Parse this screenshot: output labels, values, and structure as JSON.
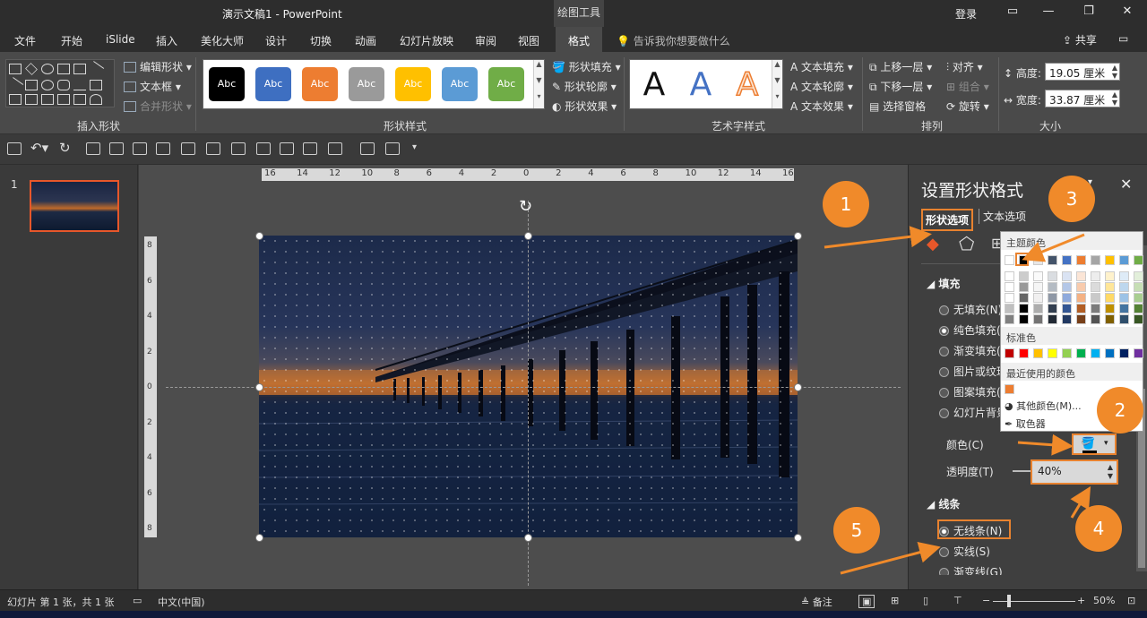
{
  "titlebar": {
    "doc_title": "演示文稿1  -  PowerPoint",
    "tool_context": "绘图工具",
    "login": "登录"
  },
  "tabs": [
    {
      "label": "文件"
    },
    {
      "label": "开始"
    },
    {
      "label": "iSlide"
    },
    {
      "label": "插入"
    },
    {
      "label": "美化大师"
    },
    {
      "label": "设计"
    },
    {
      "label": "切换"
    },
    {
      "label": "动画"
    },
    {
      "label": "幻灯片放映"
    },
    {
      "label": "审阅"
    },
    {
      "label": "视图"
    },
    {
      "label": "格式"
    }
  ],
  "tell_me": "告诉我你想要做什么",
  "share_label": "共享",
  "ribbon": {
    "insert_shapes": {
      "label": "插入形状",
      "edit_shape": "编辑形状",
      "text_box": "文本框",
      "merge_shapes": "合并形状"
    },
    "shape_styles": {
      "label": "形状样式",
      "sample_text": "Abc",
      "swatches": [
        "#000000",
        "#3e6fc1",
        "#ed7d31",
        "#9a9a9a",
        "#ffc000",
        "#5b9bd5",
        "#70ad47"
      ],
      "fill": "形状填充",
      "outline": "形状轮廓",
      "effects": "形状效果"
    },
    "wordart": {
      "label": "艺术字样式",
      "letter": "A",
      "text_fill": "文本填充",
      "text_outline": "文本轮廓",
      "text_effects": "文本效果"
    },
    "arrange": {
      "label": "排列",
      "bring_forward": "上移一层",
      "send_backward": "下移一层",
      "selection_pane": "选择窗格",
      "align": "对齐",
      "group": "组合",
      "rotate": "旋转"
    },
    "size": {
      "label": "大小",
      "height_label": "高度:",
      "height_value": "19.05 厘米",
      "width_label": "宽度:",
      "width_value": "33.87 厘米"
    }
  },
  "slide_pane": {
    "slide_number": "1"
  },
  "ruler": {
    "h_ticks": [
      "16",
      "14",
      "12",
      "10",
      "8",
      "6",
      "4",
      "2",
      "0",
      "2",
      "4",
      "6",
      "8",
      "10",
      "12",
      "14",
      "16"
    ],
    "v_ticks": [
      "8",
      "6",
      "4",
      "2",
      "0",
      "2",
      "4",
      "6",
      "8"
    ]
  },
  "format_pane": {
    "title": "设置形状格式",
    "tab_shape": "形状选项",
    "tab_text": "文本选项",
    "fill_section": "填充",
    "fill_options": [
      {
        "label": "无填充(N)",
        "selected": false
      },
      {
        "label": "纯色填充(S)",
        "selected": true
      },
      {
        "label": "渐变填充(G)",
        "selected": false
      },
      {
        "label": "图片或纹理",
        "selected": false
      },
      {
        "label": "图案填充(A)",
        "selected": false
      },
      {
        "label": "幻灯片背景",
        "selected": false
      }
    ],
    "color_label": "颜色(C)",
    "transparency_label": "透明度(T)",
    "transparency_value": "40%",
    "line_section": "线条",
    "line_options": [
      {
        "label": "无线条(N)",
        "selected": true
      },
      {
        "label": "实线(S)",
        "selected": false
      },
      {
        "label": "渐变线(G)",
        "selected": false
      }
    ]
  },
  "color_dropdown": {
    "theme_colors": "主题颜色",
    "standard_colors": "标准色",
    "recent_colors": "最近使用的颜色",
    "more_colors": "其他颜色(M)...",
    "eyedropper": "取色器",
    "theme_top_row": [
      "#ffffff",
      "#000000",
      "#e7e6e6",
      "#44546a",
      "#4472c4",
      "#ed7d31",
      "#a5a5a5",
      "#ffc000",
      "#5b9bd5",
      "#70ad47"
    ],
    "standard_row": [
      "#c00000",
      "#ff0000",
      "#ffc000",
      "#ffff00",
      "#92d050",
      "#00b050",
      "#00b0f0",
      "#0070c0",
      "#002060",
      "#7030a0"
    ],
    "recent_row": [
      "#ed7d31"
    ]
  },
  "callouts": [
    "1",
    "2",
    "3",
    "4",
    "5"
  ],
  "statusbar": {
    "slide_info": "幻灯片 第 1 张，共 1 张",
    "language": "中文(中国)",
    "notes": "备注",
    "zoom": "50%"
  }
}
